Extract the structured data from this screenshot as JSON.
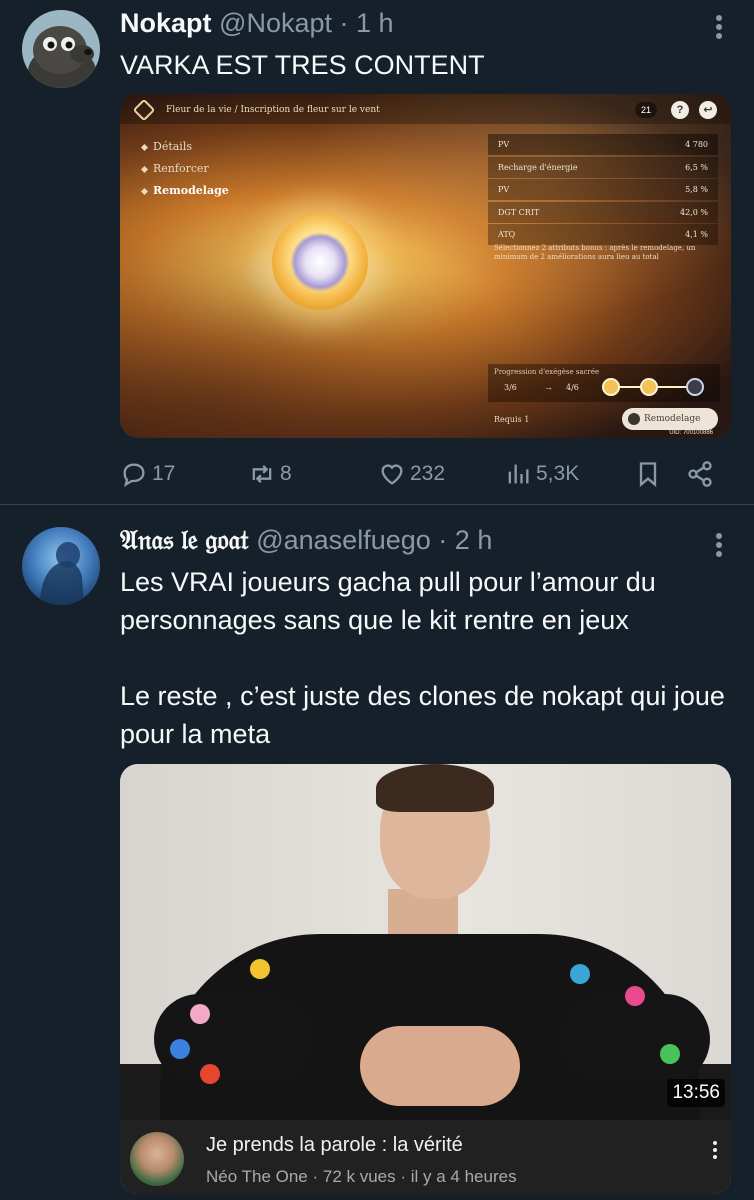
{
  "tweet1": {
    "name": "Nokapt",
    "handle": "@Nokapt",
    "dot": "·",
    "time": "1 h",
    "text": "VARKA EST TRES CONTENT",
    "game": {
      "breadcrumb": "Fleur de la vie / Inscription de fleur sur le vent",
      "resin": "21",
      "help": "?",
      "menu": [
        "Détails",
        "Renforcer",
        "Remodelage"
      ],
      "stats": [
        {
          "name": "PV",
          "value": "4 780"
        },
        {
          "name": "Recharge d'énergie",
          "value": "6,5 %"
        },
        {
          "name": "PV",
          "value": "5,8 %"
        },
        {
          "name": "DGT CRIT",
          "value": "42,0 %"
        },
        {
          "name": "ATQ",
          "value": "4,1 %"
        }
      ],
      "note": "Sélectionnez 2 attributs bonus : après le remodelage, un minimum de 2 améliorations aura lieu au total",
      "progress_label": "Progression d'exégèse sacrée",
      "progress_from": "3/6",
      "progress_arrow": "→",
      "progress_to": "4/6",
      "requis": "Requis  1",
      "button": "Remodelage",
      "uid": "UID: 700100886"
    },
    "actions": {
      "replies": "17",
      "retweets": "8",
      "likes": "232",
      "views": "5,3K"
    }
  },
  "tweet2": {
    "name": "𝔄𝔫𝔞𝔰 𝔩𝔢 𝔤𝔬𝔞𝔱",
    "handle": "@anaselfuego",
    "dot": "·",
    "time": "2 h",
    "text": "Les VRAI joueurs gacha pull pour l’amour du personnages sans que le kit rentre en jeux\n\nLe reste , c’est juste des clones de nokapt qui joue pour la meta",
    "video": {
      "duration": "13:56",
      "title": "Je prends la parole : la vérité",
      "meta": "Néo The One · 72 k vues · il y a 4 heures"
    }
  },
  "colors": {
    "background": "#15202b",
    "text": "#f7f9f9",
    "secondary": "#8b98a5",
    "divider": "#38444d"
  }
}
